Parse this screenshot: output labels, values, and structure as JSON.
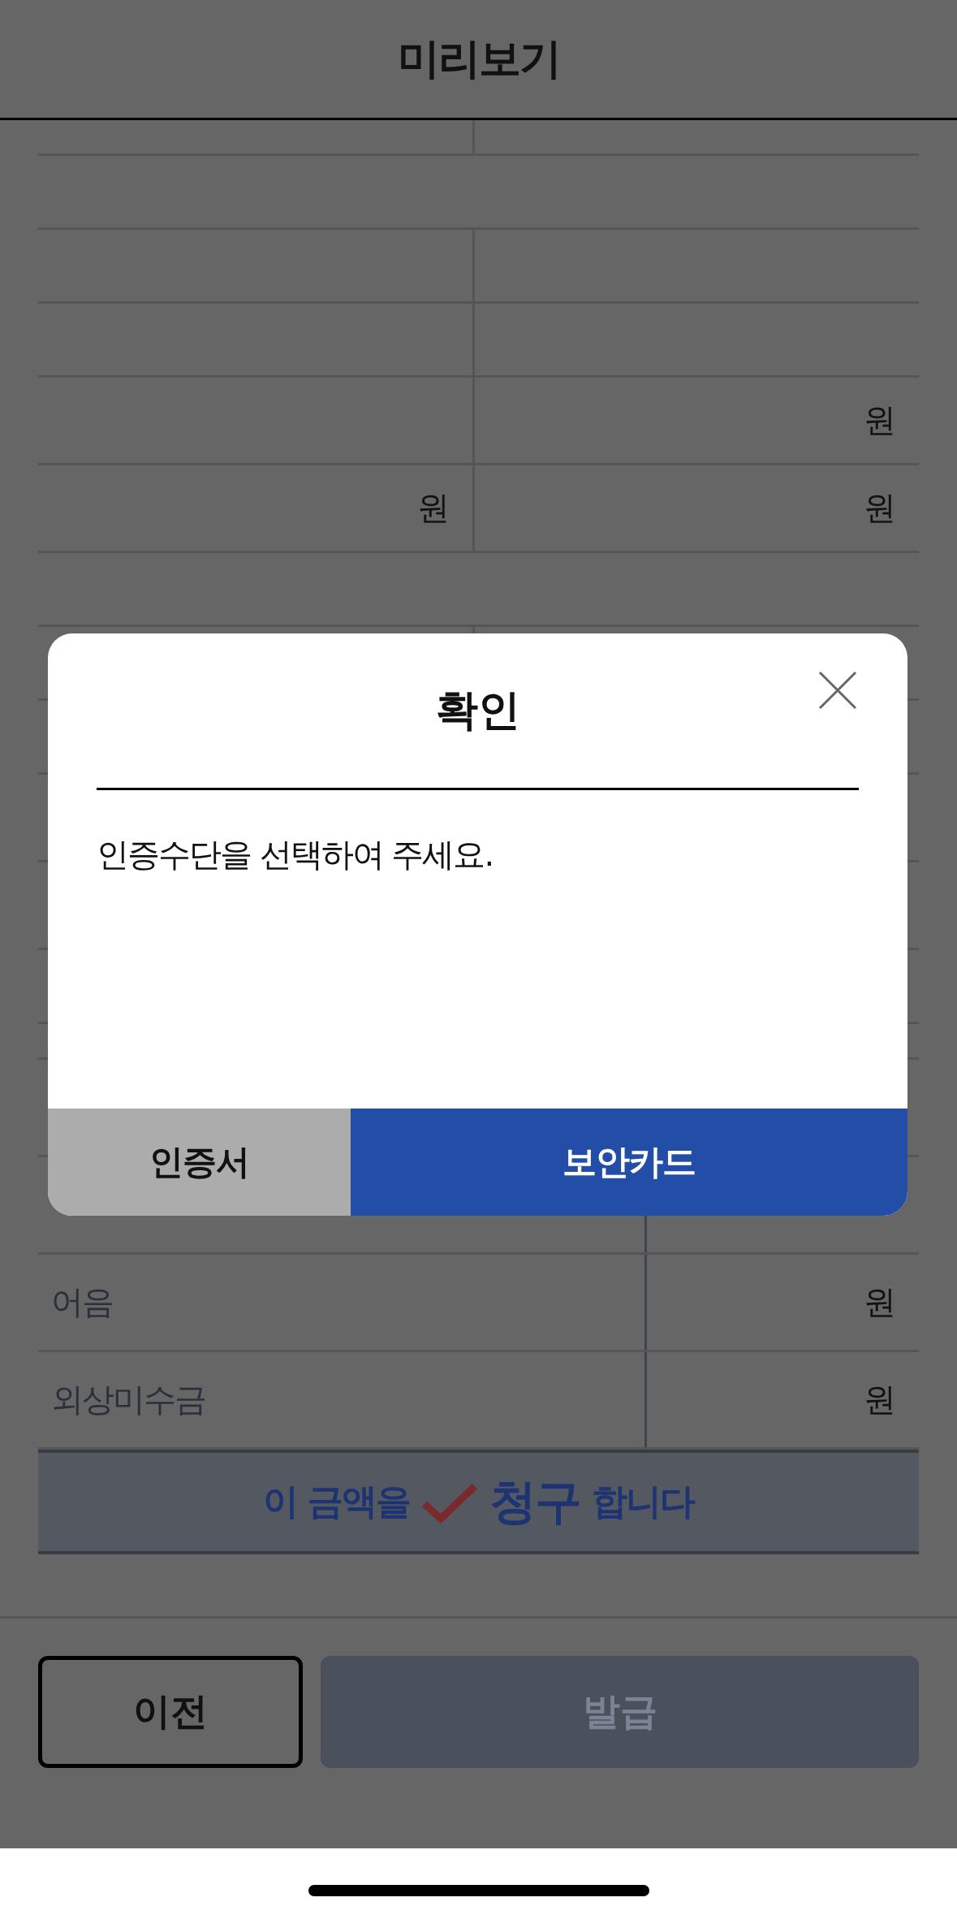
{
  "header": {
    "title": "미리보기"
  },
  "table_rows": [
    {
      "kind": "split"
    },
    {
      "kind": "full"
    },
    {
      "kind": "split"
    },
    {
      "kind": "split"
    },
    {
      "kind": "split",
      "right": "원"
    },
    {
      "kind": "split",
      "left": "원",
      "right": "원"
    },
    {
      "kind": "full"
    },
    {
      "kind": "split"
    },
    {
      "kind": "split"
    },
    {
      "kind": "split"
    },
    {
      "kind": "split"
    },
    {
      "kind": "split"
    },
    {
      "kind": "full"
    },
    {
      "kind": "split"
    },
    {
      "kind": "wide"
    },
    {
      "kind": "wide",
      "label": "어음",
      "right": "원"
    },
    {
      "kind": "wide",
      "label": "외상미수금",
      "right": "원"
    }
  ],
  "claim": {
    "prefix": "이 금액을",
    "checked": true,
    "emphasis": "청구",
    "suffix": "합니다"
  },
  "footer_buttons": [
    {
      "label": "이전",
      "kind": "outline",
      "disabled": false
    },
    {
      "label": "발급",
      "kind": "primary",
      "disabled": true
    }
  ],
  "dialog": {
    "title": "확인",
    "message": "인증수단을 선택하여 주세요.",
    "buttons": [
      {
        "label": "인증서",
        "kind": "secondary"
      },
      {
        "label": "보안카드",
        "kind": "primary"
      }
    ]
  }
}
